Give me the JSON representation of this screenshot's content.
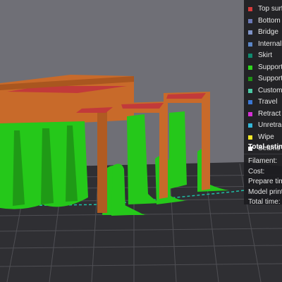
{
  "legend": {
    "items": [
      {
        "label": "Top surf",
        "color": "#d63b3b"
      },
      {
        "label": "Bottom",
        "color": "#6a78b6"
      },
      {
        "label": "Bridge",
        "color": "#7f93c7"
      },
      {
        "label": "Internal",
        "color": "#5b86c7"
      },
      {
        "label": "Skirt",
        "color": "#0f8a6e"
      },
      {
        "label": "Support",
        "color": "#2fd61f"
      },
      {
        "label": "Support",
        "color": "#1f8f16"
      },
      {
        "label": "Custom",
        "color": "#4bc9a4"
      },
      {
        "label": "Travel",
        "color": "#3b78d6"
      },
      {
        "label": "Retract",
        "color": "#d62fd6"
      },
      {
        "label": "Unretrac",
        "color": "#33b7d9"
      },
      {
        "label": "Wipe",
        "color": "#f2e82b"
      },
      {
        "label": "Seams",
        "color": "#f2f2f2"
      }
    ]
  },
  "estimate": {
    "title": "Total estim",
    "rows": [
      "Filament:",
      "Cost:",
      "Prepare tim",
      "Model print",
      "Total time:"
    ]
  },
  "colors": {
    "background": "#6f6f76",
    "plate": "#2f2f33",
    "plate_grid": "#545458",
    "bed_edge": "#1f9a8a",
    "model_wall": "#c86a2a",
    "model_top": "#c23a3a",
    "support": "#25c81a"
  }
}
